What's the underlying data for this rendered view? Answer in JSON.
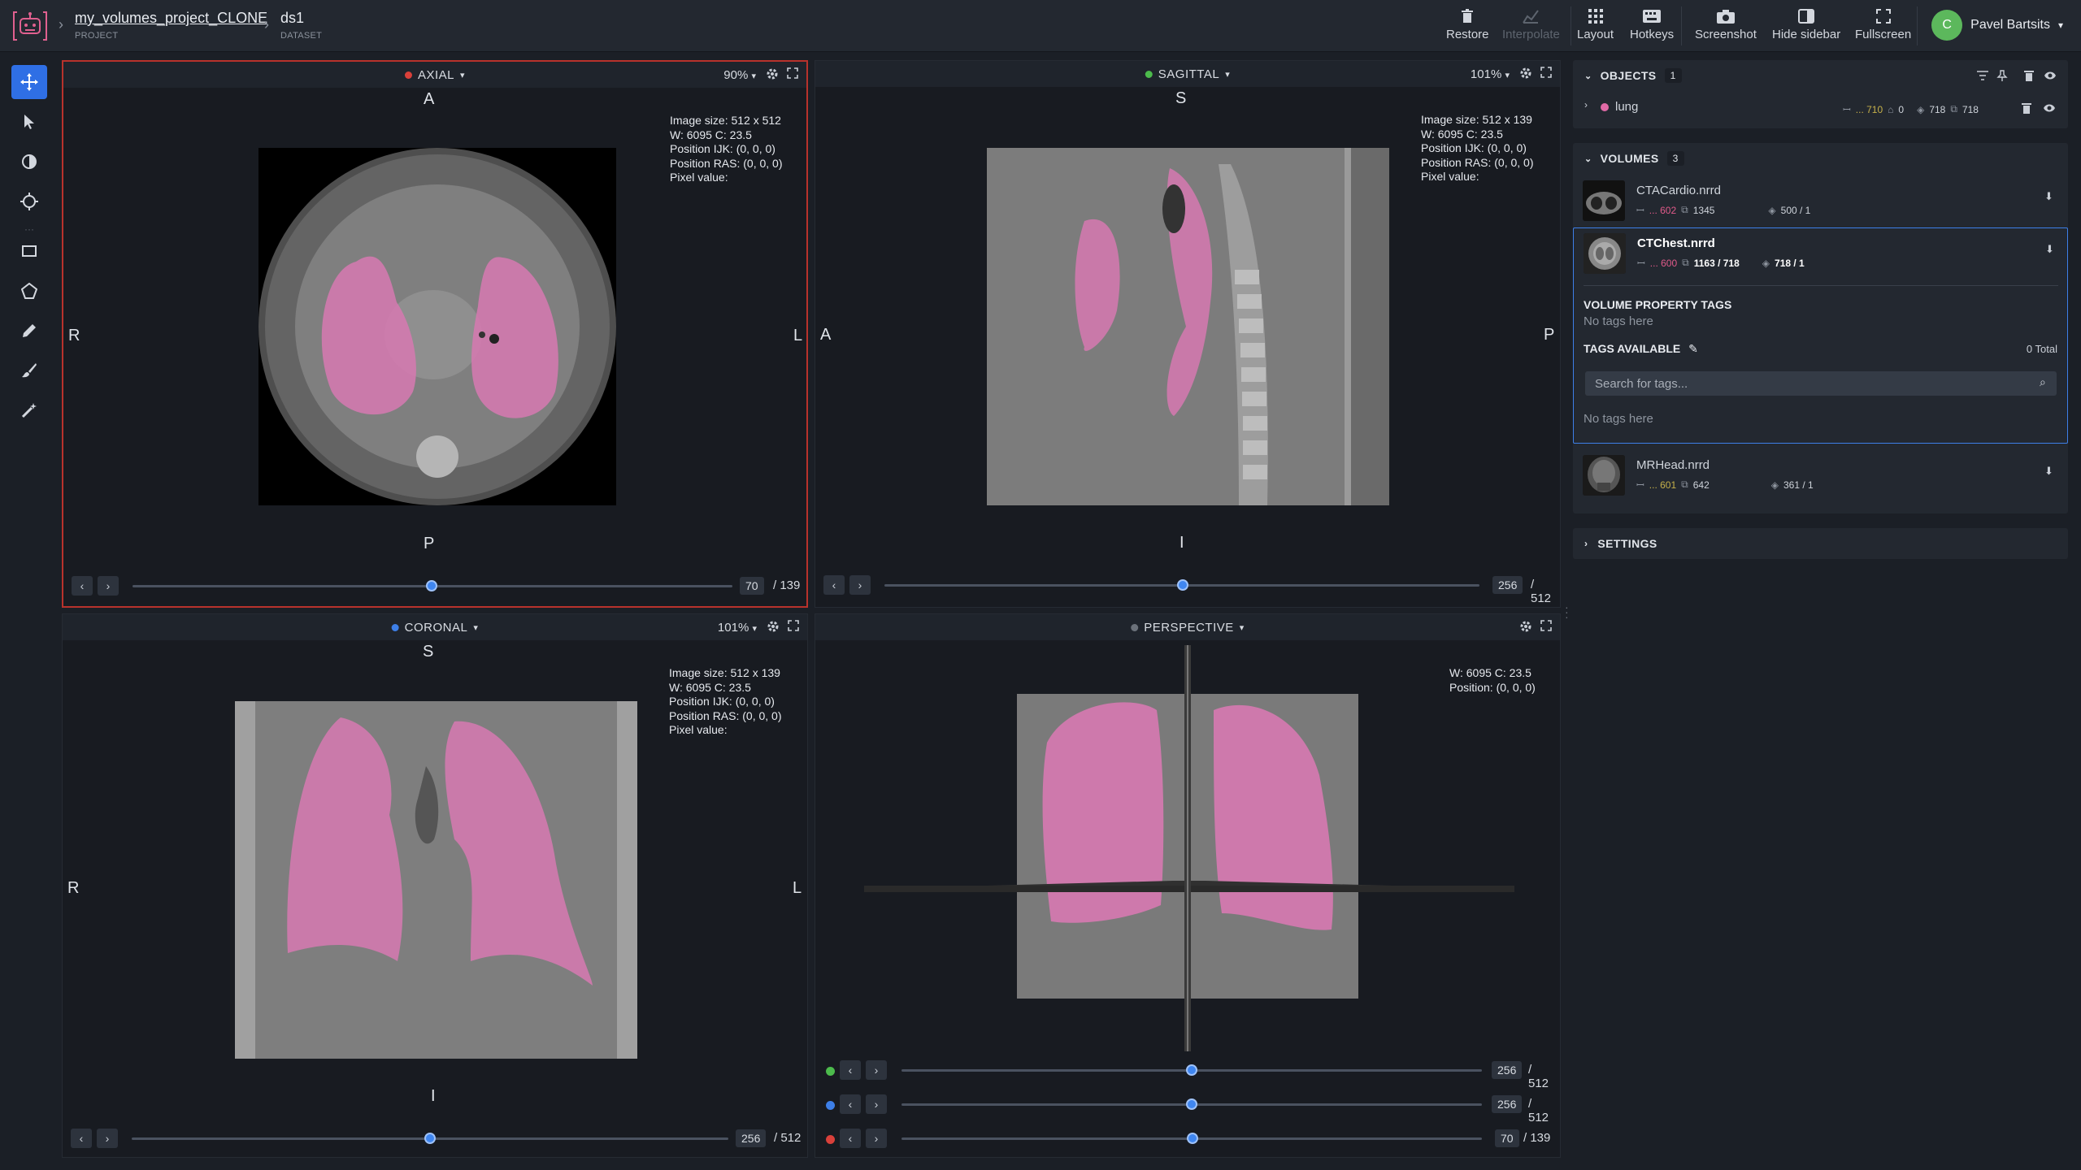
{
  "header": {
    "project_name": "my_volumes_project_CLONE",
    "project_label": "PROJECT",
    "dataset_name": "ds1",
    "dataset_label": "DATASET",
    "buttons": {
      "restore": "Restore",
      "interpolate": "Interpolate",
      "layout": "Layout",
      "hotkeys": "Hotkeys",
      "screenshot": "Screenshot",
      "hide_sidebar": "Hide sidebar",
      "fullscreen": "Fullscreen"
    },
    "user": {
      "initial": "C",
      "name": "Pavel Bartsits"
    }
  },
  "viewports": {
    "axial": {
      "title": "AXIAL",
      "zoom": "90%",
      "dot_color": "#d9403a",
      "top": "A",
      "bottom": "P",
      "left": "R",
      "right": "L",
      "info": [
        "Image size: 512 x 512",
        "W: 6095 C: 23.5",
        "Position IJK: (0, 0, 0)",
        "Position RAS: (0, 0, 0)",
        "Pixel value:"
      ],
      "slice": "70",
      "max": "/ 139"
    },
    "sagittal": {
      "title": "SAGITTAL",
      "zoom": "101%",
      "dot_color": "#4cbb4c",
      "top": "S",
      "bottom": "I",
      "left": "A",
      "right": "P",
      "info": [
        "Image size: 512 x 139",
        "W: 6095 C: 23.5",
        "Position IJK: (0, 0, 0)",
        "Position RAS: (0, 0, 0)",
        "Pixel value:"
      ],
      "slice": "256",
      "max": "/ 512"
    },
    "coronal": {
      "title": "CORONAL",
      "zoom": "101%",
      "dot_color": "#3d7fe8",
      "top": "S",
      "bottom": "I",
      "left": "R",
      "right": "L",
      "info": [
        "Image size: 512 x 139",
        "W: 6095 C: 23.5",
        "Position IJK: (0, 0, 0)",
        "Position RAS: (0, 0, 0)",
        "Pixel value:"
      ],
      "slice": "256",
      "max": "/ 512"
    },
    "perspective": {
      "title": "PERSPECTIVE",
      "dot_color": "#6b717a",
      "info": [
        "W: 6095 C: 23.5",
        "Position: (0, 0, 0)"
      ],
      "sliders": [
        {
          "color": "#4cbb4c",
          "value": "256",
          "max": "/ 512"
        },
        {
          "color": "#3d7fe8",
          "value": "256",
          "max": "/ 512"
        },
        {
          "color": "#d9403a",
          "value": "70",
          "max": "/ 139"
        }
      ]
    }
  },
  "sidebar": {
    "objects": {
      "label": "OBJECTS",
      "count": "1",
      "items": [
        {
          "name": "lung",
          "id": "... 710",
          "tags": "0",
          "stat1": "718",
          "stat2": "718",
          "color": "#e06aa6"
        }
      ]
    },
    "volumes": {
      "label": "VOLUMES",
      "count": "3",
      "items": [
        {
          "name": "CTACardio.nrrd",
          "id": "... 602",
          "frames": "1345",
          "objects": "500 / 1"
        },
        {
          "name": "CTChest.nrrd",
          "id": "... 600",
          "frames": "1163 / 718",
          "objects": "718 / 1"
        },
        {
          "name": "MRHead.nrrd",
          "id": "... 601",
          "frames": "642",
          "objects": "361 / 1"
        }
      ],
      "property_tags_title": "VOLUME PROPERTY TAGS",
      "property_tags_empty": "No tags here",
      "tags_available_title": "TAGS AVAILABLE",
      "tags_total": "0 Total",
      "search_placeholder": "Search for tags...",
      "tags_empty": "No tags here"
    },
    "settings": {
      "label": "SETTINGS"
    }
  }
}
